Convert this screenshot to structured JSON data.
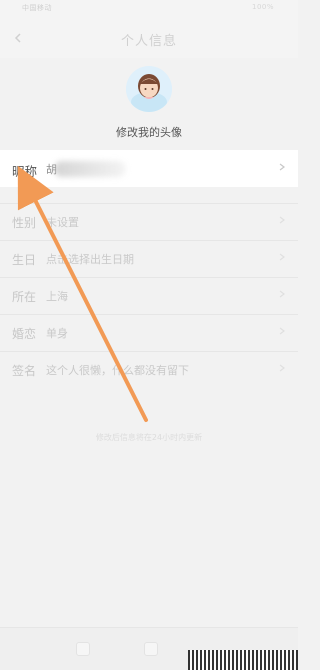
{
  "status_bar": {
    "left": "中国移动",
    "right": "100%"
  },
  "header": {
    "title": "个人信息"
  },
  "profile": {
    "avatar_label": "修改我的头像"
  },
  "rows": {
    "nickname": {
      "label": "昵称",
      "value": "胡"
    },
    "gender": {
      "label": "性别",
      "value": "未设置"
    },
    "birthday": {
      "label": "生日",
      "value": "点击选择出生日期"
    },
    "location": {
      "label": "所在",
      "value": "上海"
    },
    "status": {
      "label": "婚恋",
      "value": "单身"
    },
    "signature": {
      "label": "签名",
      "value": "这个人很懒，什么都没有留下"
    }
  },
  "footer": {
    "hint": "修改后信息将在24小时内更新"
  },
  "colors": {
    "accent_arrow": "#f29a55",
    "background": "#f2f2f2",
    "highlight_row": "#ffffff"
  }
}
